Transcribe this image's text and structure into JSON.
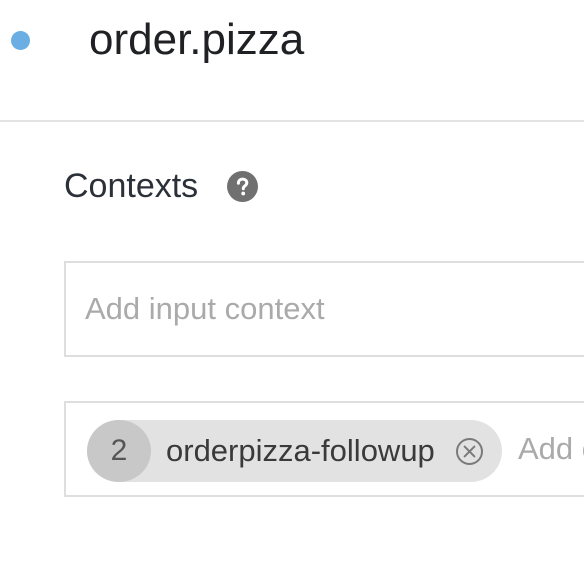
{
  "header": {
    "status_dot_color": "#6aaee3",
    "intent_name": "order.pizza"
  },
  "contexts_section": {
    "title": "Contexts",
    "help_icon": "question-circle-icon",
    "input_context": {
      "value": "",
      "placeholder": "Add input context"
    },
    "output_context": {
      "chips": [
        {
          "lifespan": "2",
          "name": "orderpizza-followup",
          "remove_icon": "close-circle-icon"
        }
      ],
      "placeholder": "Add output context"
    }
  }
}
